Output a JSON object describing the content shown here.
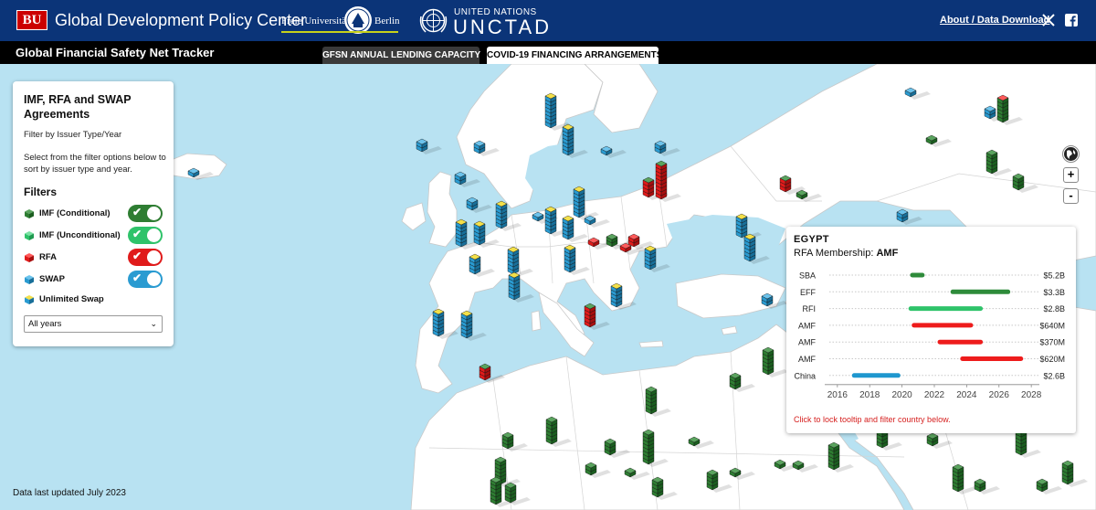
{
  "header": {
    "bu_logo": "BU",
    "center_name": "Global Development Policy Center",
    "fu_left": "Freie Universität",
    "fu_right": "Berlin",
    "un_small": "UNITED NATIONS",
    "un_big": "UNCTAD",
    "about_link": "About / Data Download",
    "social_icons": [
      "x-icon",
      "facebook-icon"
    ]
  },
  "nav": {
    "title": "Global Financial Safety Net Tracker",
    "tabs": [
      {
        "label": "GFSN ANNUAL LENDING CAPACITY",
        "active": false
      },
      {
        "label": "COVID-19 FINANCING ARRANGEMENTS",
        "active": true
      }
    ]
  },
  "panel": {
    "title": "IMF, RFA and SWAP Agreements",
    "subtitle": "Filter by Issuer Type/Year",
    "description": "Select from the filter options below to sort by issuer type and year.",
    "filters_heading": "Filters",
    "filters": [
      {
        "label": "IMF (Conditional)",
        "color": "#2e7d32",
        "toggle": true
      },
      {
        "label": "IMF (Unconditional)",
        "color": "#2fc36a",
        "toggle": true
      },
      {
        "label": "RFA",
        "color": "#e01b1b",
        "toggle": true
      },
      {
        "label": "SWAP",
        "color": "#2a9bd1",
        "toggle": true
      },
      {
        "label": "Unlimited Swap",
        "color": "#e8d21c",
        "toggle": false
      }
    ],
    "year_select": "All years"
  },
  "map_controls": {
    "globe": "globe-icon",
    "zoom_in": "+",
    "zoom_out": "-"
  },
  "last_updated": "Data last updated July 2023",
  "tooltip": {
    "country": "EGYPT",
    "membership_label": "RFA Membership:",
    "membership_value": "AMF",
    "hint": "Click to lock tooltip and filter country below."
  },
  "chart_data": {
    "type": "bar",
    "orientation": "horizontal-range",
    "x_axis": {
      "range": [
        2015.5,
        2028.5
      ],
      "ticks": [
        2016,
        2018,
        2020,
        2022,
        2024,
        2026,
        2028
      ]
    },
    "rows": [
      {
        "label": "SBA",
        "start": 2020.5,
        "end": 2021.4,
        "amount": "$5.2B",
        "color": "#2e8b3a"
      },
      {
        "label": "EFF",
        "start": 2023.0,
        "end": 2026.7,
        "amount": "$3.3B",
        "color": "#2e8b3a"
      },
      {
        "label": "RFI",
        "start": 2020.4,
        "end": 2025.0,
        "amount": "$2.8B",
        "color": "#2fc36a"
      },
      {
        "label": "AMF",
        "start": 2020.6,
        "end": 2024.4,
        "amount": "$640M",
        "color": "#ee1c1c"
      },
      {
        "label": "AMF",
        "start": 2022.2,
        "end": 2025.0,
        "amount": "$370M",
        "color": "#ee1c1c"
      },
      {
        "label": "AMF",
        "start": 2023.6,
        "end": 2027.5,
        "amount": "$620M",
        "color": "#ee1c1c"
      },
      {
        "label": "China",
        "start": 2016.9,
        "end": 2019.9,
        "amount": "$2.6B",
        "color": "#1f97cf"
      }
    ]
  }
}
